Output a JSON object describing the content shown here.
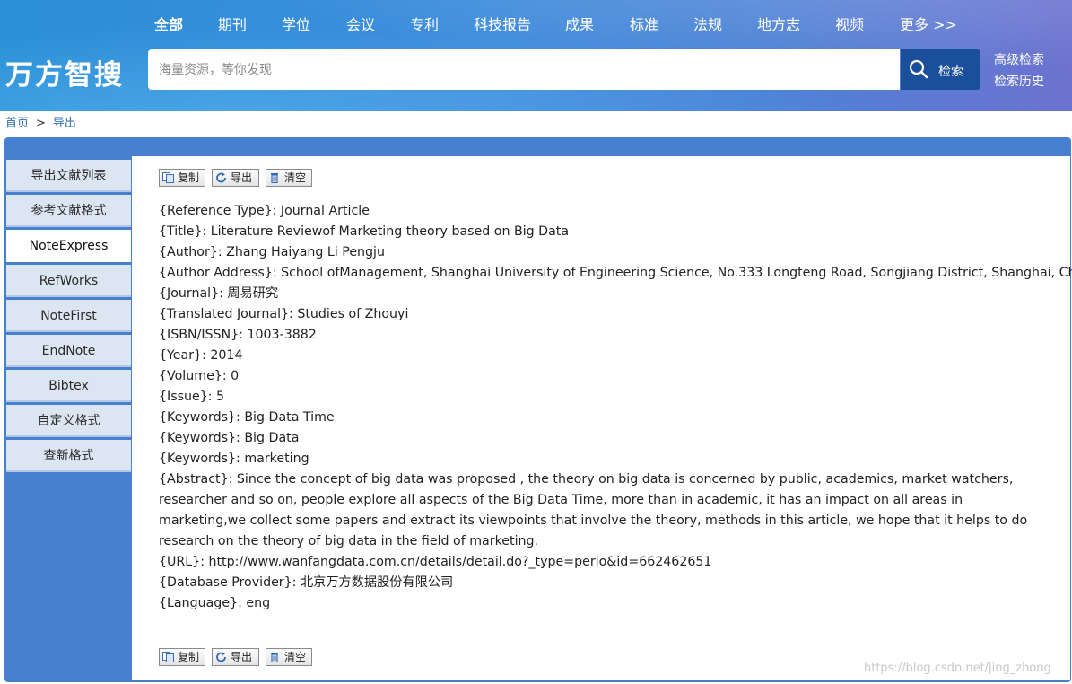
{
  "nav": {
    "items": [
      "全部",
      "期刊",
      "学位",
      "会议",
      "专利",
      "科技报告",
      "成果",
      "标准",
      "法规",
      "地方志",
      "视频",
      "更多 >>"
    ]
  },
  "brand": {
    "name": "万方智搜"
  },
  "search": {
    "placeholder": "海量资源，等你发现",
    "button_label": "检索"
  },
  "side_links": {
    "advanced": "高级检索",
    "history": "检索历史"
  },
  "breadcrumb": {
    "home": "首页",
    "separator": ">",
    "current": "导出"
  },
  "tabs": [
    "导出文献列表",
    "参考文献格式",
    "NoteExpress",
    "RefWorks",
    "NoteFirst",
    "EndNote",
    "Bibtex",
    "自定义格式",
    "查新格式"
  ],
  "active_tab": "NoteExpress",
  "toolbar": {
    "copy": "复制",
    "export": "导出",
    "clear": "清空"
  },
  "record": {
    "reference_type": "{Reference Type}: Journal Article",
    "title": "{Title}: Literature Reviewof Marketing theory based on Big Data",
    "author": "{Author}: Zhang Haiyang Li Pengju",
    "author_address": "{Author Address}: School ofManagement, Shanghai University of Engineering Science, No.333 Longteng Road, Songjiang District, Shanghai, China",
    "journal": "{Journal}: 周易研究",
    "translated_journal": "{Translated Journal}: Studies of Zhouyi",
    "isbn_issn": "{ISBN/ISSN}: 1003-3882",
    "year": "{Year}: 2014",
    "volume": "{Volume}: 0",
    "issue": "{Issue}: 5",
    "keywords_1": "{Keywords}: Big Data Time",
    "keywords_2": "{Keywords}: Big Data",
    "keywords_3": "{Keywords}: marketing",
    "abstract": "{Abstract}: Since the concept of big data was proposed , the theory on big data is concerned by public, academics, market watchers, researcher and so on, people explore all aspects of the Big Data Time, more than in academic, it has an impact on all areas in marketing,we collect some papers and extract its viewpoints that involve the theory, methods in this article, we hope that it helps to do research on the theory of big data in the field of marketing.",
    "url": "{URL}: http://www.wanfangdata.com.cn/details/detail.do?_type=perio&id=662462651",
    "database_provider": "{Database Provider}: 北京万方数据股份有限公司",
    "language": "{Language}: eng"
  },
  "watermark": "https://blog.csdn.net/jing_zhong",
  "colors": {
    "panel": "#4680ce",
    "search_button": "#1a4f9c",
    "tab_bg": "#dce6f2",
    "link": "#2b6cb0"
  }
}
